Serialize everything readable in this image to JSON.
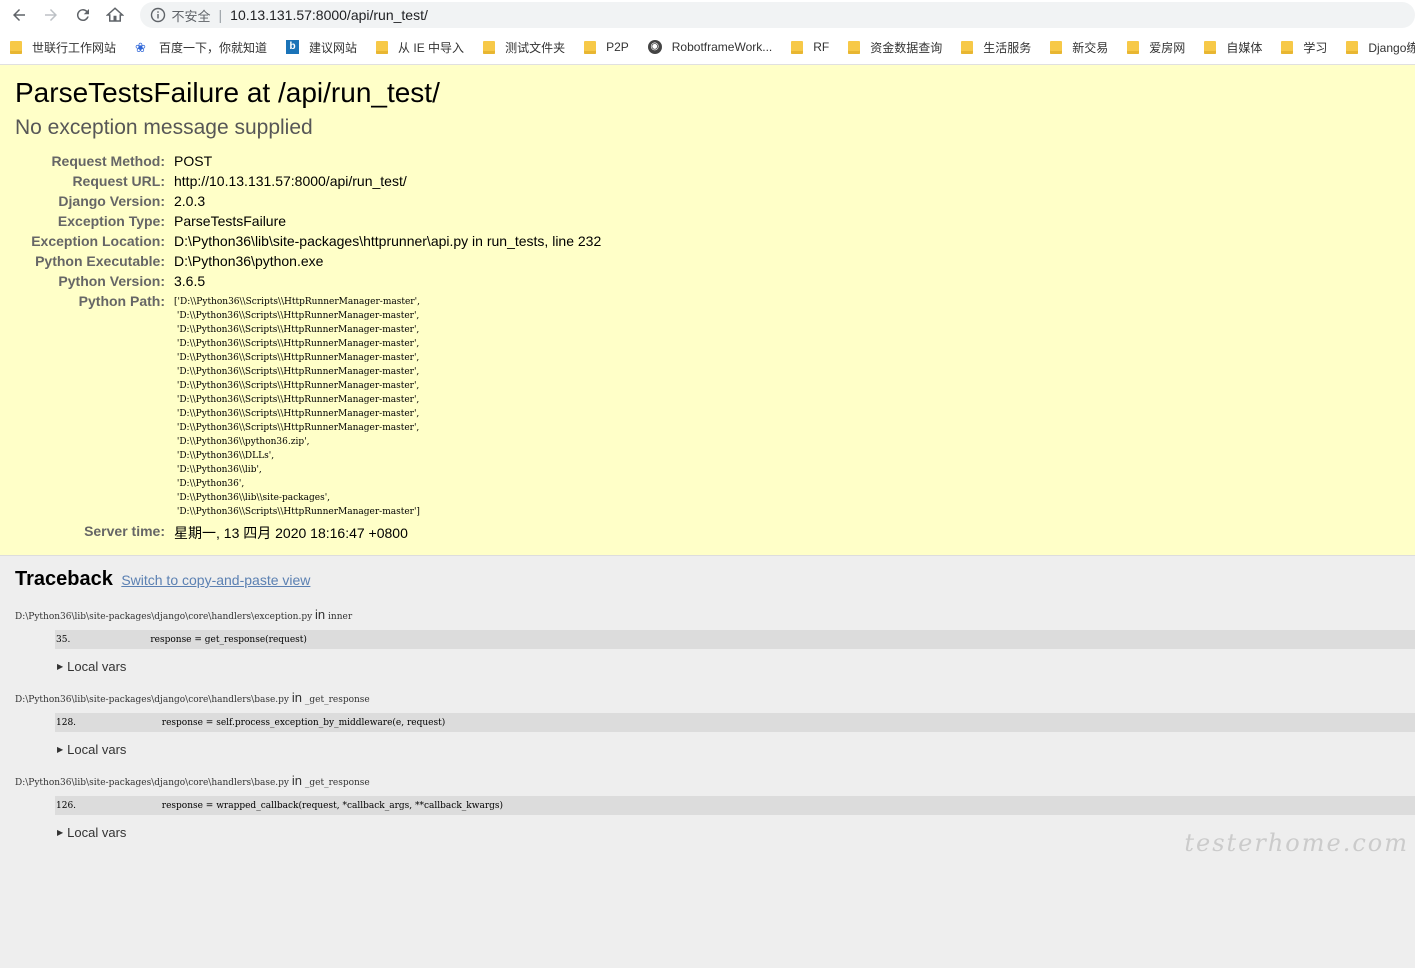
{
  "browser": {
    "insecure_label": "不安全",
    "separator": "|",
    "url": "10.13.131.57:8000/api/run_test/"
  },
  "bookmarks": [
    {
      "label": "世联行工作网站",
      "icon": "folder"
    },
    {
      "label": "百度一下，你就知道",
      "icon": "baidu-paw"
    },
    {
      "label": "建议网站",
      "icon": "bing"
    },
    {
      "label": "从 IE 中导入",
      "icon": "folder"
    },
    {
      "label": "测试文件夹",
      "icon": "folder"
    },
    {
      "label": "P2P",
      "icon": "folder"
    },
    {
      "label": "RobotframeWork...",
      "icon": "globe"
    },
    {
      "label": "RF",
      "icon": "folder"
    },
    {
      "label": "资金数据查询",
      "icon": "folder"
    },
    {
      "label": "生活服务",
      "icon": "folder"
    },
    {
      "label": "新交易",
      "icon": "folder"
    },
    {
      "label": "爱房网",
      "icon": "folder"
    },
    {
      "label": "自媒体",
      "icon": "folder"
    },
    {
      "label": "学习",
      "icon": "folder"
    },
    {
      "label": "Django练",
      "icon": "folder"
    }
  ],
  "error": {
    "title": "ParseTestsFailure at /api/run_test/",
    "message": "No exception message supplied",
    "meta": [
      {
        "label": "Request Method:",
        "value": "POST"
      },
      {
        "label": "Request URL:",
        "value": "http://10.13.131.57:8000/api/run_test/"
      },
      {
        "label": "Django Version:",
        "value": "2.0.3"
      },
      {
        "label": "Exception Type:",
        "value": "ParseTestsFailure"
      },
      {
        "label": "Exception Location:",
        "value": "D:\\Python36\\lib\\site-packages\\httprunner\\api.py in run_tests, line 232"
      },
      {
        "label": "Python Executable:",
        "value": "D:\\Python36\\python.exe"
      },
      {
        "label": "Python Version:",
        "value": "3.6.5"
      }
    ],
    "python_path_label": "Python Path:",
    "python_path": "['D:\\\\Python36\\\\Scripts\\\\HttpRunnerManager-master',\n 'D:\\\\Python36\\\\Scripts\\\\HttpRunnerManager-master',\n 'D:\\\\Python36\\\\Scripts\\\\HttpRunnerManager-master',\n 'D:\\\\Python36\\\\Scripts\\\\HttpRunnerManager-master',\n 'D:\\\\Python36\\\\Scripts\\\\HttpRunnerManager-master',\n 'D:\\\\Python36\\\\Scripts\\\\HttpRunnerManager-master',\n 'D:\\\\Python36\\\\Scripts\\\\HttpRunnerManager-master',\n 'D:\\\\Python36\\\\Scripts\\\\HttpRunnerManager-master',\n 'D:\\\\Python36\\\\Scripts\\\\HttpRunnerManager-master',\n 'D:\\\\Python36\\\\Scripts\\\\HttpRunnerManager-master',\n 'D:\\\\Python36\\\\python36.zip',\n 'D:\\\\Python36\\\\DLLs',\n 'D:\\\\Python36\\\\lib',\n 'D:\\\\Python36',\n 'D:\\\\Python36\\\\lib\\\\site-packages',\n 'D:\\\\Python36\\\\Scripts\\\\HttpRunnerManager-master']",
    "server_time_label": "Server time:",
    "server_time": "星期一, 13 四月 2020 18:16:47 +0800"
  },
  "traceback": {
    "title": "Traceback",
    "switch_link": "Switch to copy-and-paste view",
    "frames": [
      {
        "file": "D:\\Python36\\lib\\site-packages\\django\\core\\handlers\\exception.py",
        "in": "in",
        "func": "inner",
        "lineno": "35.",
        "code": "response = get_response(request)",
        "indent": "            ",
        "locals": "Local vars"
      },
      {
        "file": "D:\\Python36\\lib\\site-packages\\django\\core\\handlers\\base.py",
        "in": "in",
        "func": "_get_response",
        "lineno": "128.",
        "code": "response = self.process_exception_by_middleware(e, request)",
        "indent": "                ",
        "locals": "Local vars"
      },
      {
        "file": "D:\\Python36\\lib\\site-packages\\django\\core\\handlers\\base.py",
        "in": "in",
        "func": "_get_response",
        "lineno": "126.",
        "code": "response = wrapped_callback(request, *callback_args, **callback_kwargs)",
        "indent": "                ",
        "locals": "Local vars"
      }
    ]
  },
  "watermark": "testerhome.com"
}
